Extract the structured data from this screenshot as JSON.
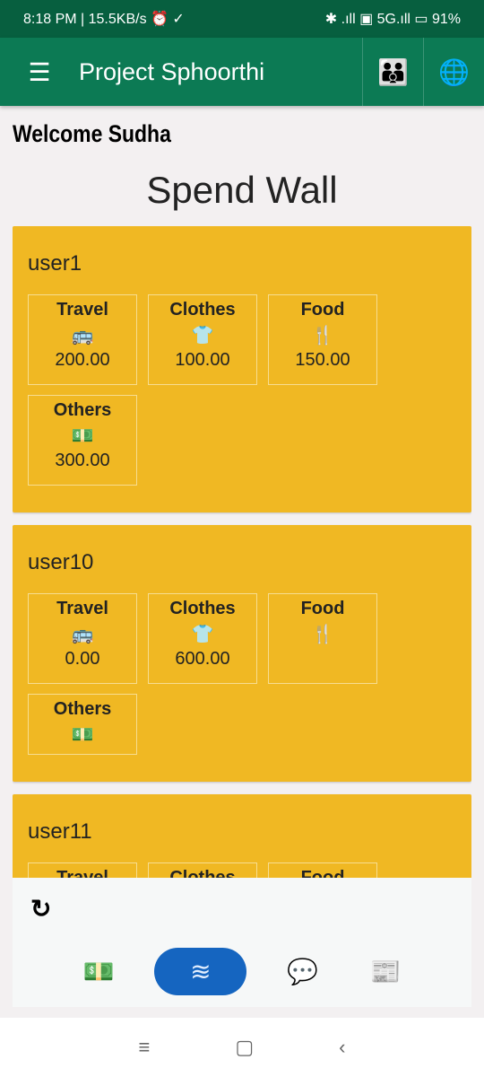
{
  "status": {
    "left": "8:18 PM | 15.5KB/s ⏰ ✓",
    "right": "✱ .ıll ▣ 5G.ıll ▭ 91%"
  },
  "appbar": {
    "title": "Project Sphoorthi",
    "menu_icon": "☰",
    "group_icon": "👪",
    "globe_icon": "🌐"
  },
  "welcome": "Welcome Sudha",
  "page_title": "Spend Wall",
  "icons": {
    "Travel": "🚌",
    "Clothes": "👕",
    "Food": "🍴",
    "Others": "💵"
  },
  "users": [
    {
      "name": "user1",
      "items": [
        {
          "label": "Travel",
          "amount": "200.00"
        },
        {
          "label": "Clothes",
          "amount": "100.00"
        },
        {
          "label": "Food",
          "amount": "150.00"
        },
        {
          "label": "Others",
          "amount": "300.00"
        }
      ]
    },
    {
      "name": "user10",
      "items": [
        {
          "label": "Travel",
          "amount": "0.00"
        },
        {
          "label": "Clothes",
          "amount": "600.00"
        },
        {
          "label": "Food",
          "amount": ""
        },
        {
          "label": "Others",
          "amount": ""
        }
      ]
    },
    {
      "name": "user11",
      "items": [
        {
          "label": "Travel",
          "amount": ""
        },
        {
          "label": "Clothes",
          "amount": ""
        },
        {
          "label": "Food",
          "amount": ""
        }
      ]
    }
  ],
  "bottom": {
    "refresh_icon": "↻",
    "nav": [
      {
        "name": "money",
        "icon": "💵"
      },
      {
        "name": "layers",
        "icon": "≋",
        "active": true
      },
      {
        "name": "chat",
        "icon": "💬"
      },
      {
        "name": "news",
        "icon": "📰"
      }
    ]
  },
  "sysnav": {
    "menu": "≡",
    "home": "▢",
    "back": "‹"
  }
}
